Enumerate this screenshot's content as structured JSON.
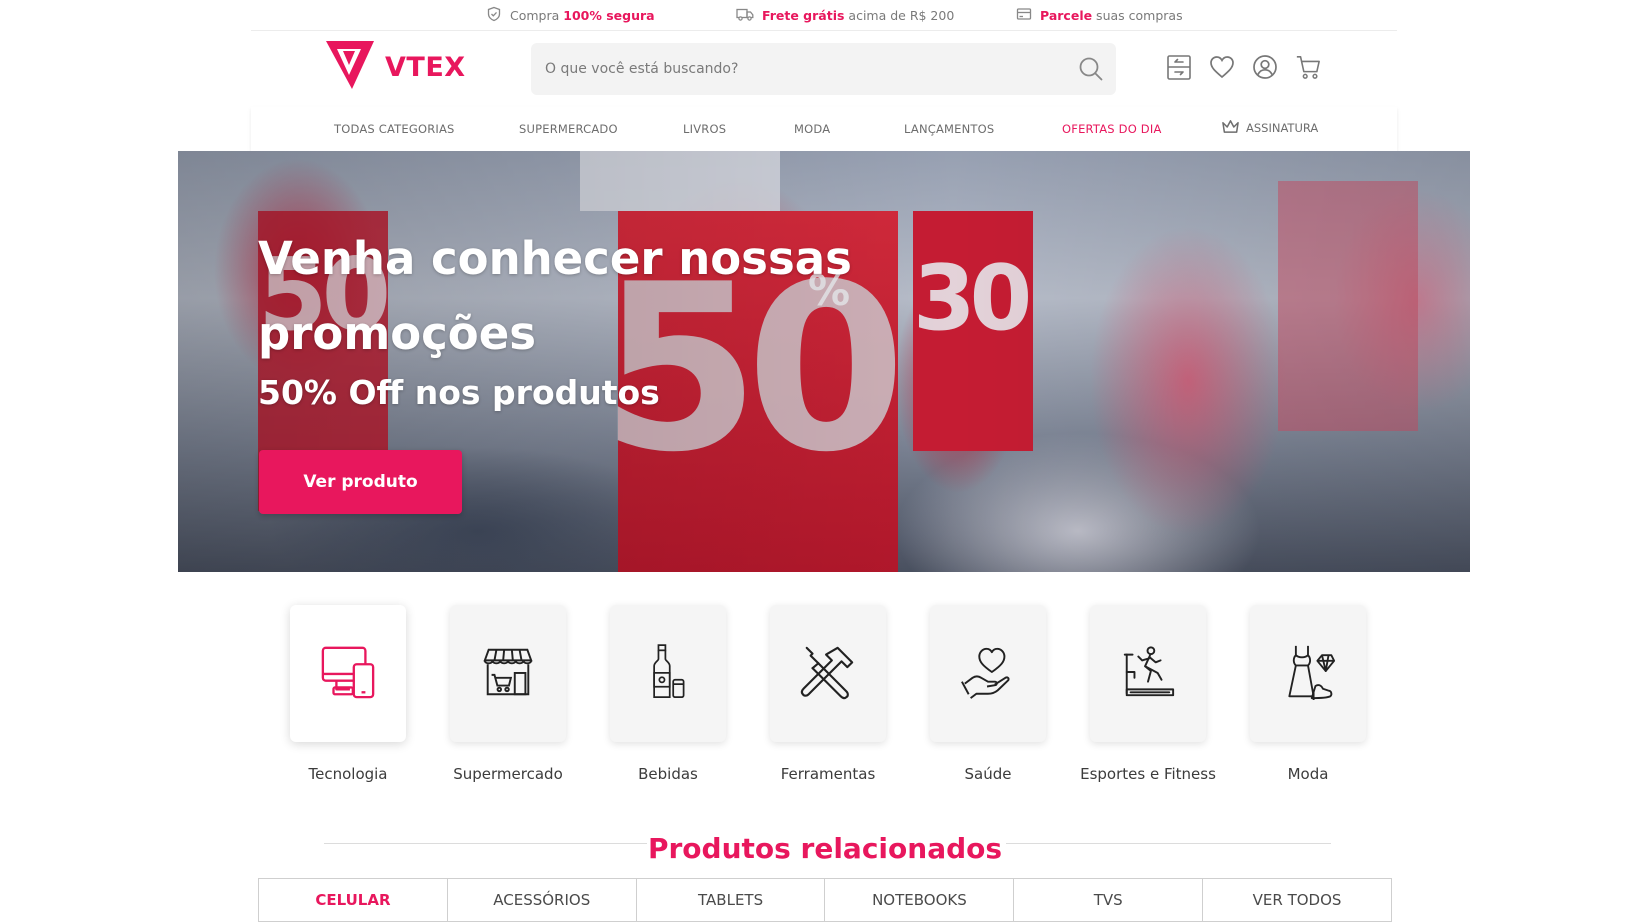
{
  "topbar": {
    "secure": {
      "prefix": "Compra ",
      "highlight": "100% segura",
      "icon": "shield-check-icon"
    },
    "shipping": {
      "highlight": "Frete grátis",
      "suffix": " acima de R$ 200",
      "icon": "truck-icon"
    },
    "installments": {
      "highlight": "Parcele",
      "suffix": " suas compras",
      "icon": "credit-card-icon"
    }
  },
  "header": {
    "logo_text": "VTEX",
    "search": {
      "placeholder": "O que você está buscando?"
    },
    "icons": [
      "compare-icon",
      "heart-icon",
      "user-icon",
      "cart-icon"
    ]
  },
  "nav": {
    "items": [
      {
        "label": "TODAS CATEGORIAS"
      },
      {
        "label": "SUPERMERCADO"
      },
      {
        "label": "LIVROS"
      },
      {
        "label": "MODA"
      },
      {
        "label": "LANÇAMENTOS"
      },
      {
        "label": "OFERTAS DO DIA"
      }
    ],
    "subscription": {
      "label": "ASSINATURA",
      "icon": "crown-icon"
    }
  },
  "hero": {
    "headline": "Venha conhecer nossas promoções",
    "subheadline": "50% Off nos produtos",
    "cta": "Ver produto",
    "background_text": {
      "big": "50",
      "pct": "%",
      "side": "30",
      "left": "50"
    }
  },
  "categories": [
    {
      "label": "Tecnologia",
      "icon": "devices-icon",
      "active": true
    },
    {
      "label": "Supermercado",
      "icon": "store-icon"
    },
    {
      "label": "Bebidas",
      "icon": "bottle-icon"
    },
    {
      "label": "Ferramentas",
      "icon": "tools-icon"
    },
    {
      "label": "Saúde",
      "icon": "heart-hand-icon"
    },
    {
      "label": "Esportes e Fitness",
      "icon": "treadmill-icon"
    },
    {
      "label": "Moda",
      "icon": "dress-icon"
    }
  ],
  "related": {
    "title": "Produtos relacionados",
    "tabs": [
      {
        "label": "CELULAR",
        "active": true
      },
      {
        "label": "ACESSÓRIOS"
      },
      {
        "label": "TABLETS"
      },
      {
        "label": "NOTEBOOKS"
      },
      {
        "label": "TVS"
      },
      {
        "label": "VER TODOS"
      }
    ]
  },
  "colors": {
    "accent": "#e8175d",
    "text": "#3c3c3c",
    "muted": "#7a7a7a"
  }
}
